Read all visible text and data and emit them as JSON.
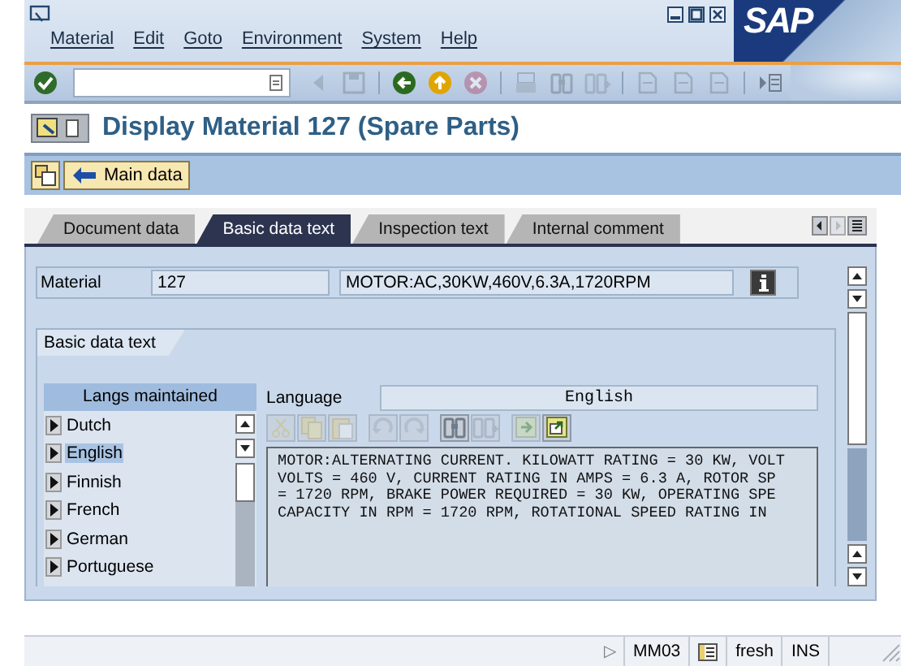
{
  "menu_bar": {
    "items": [
      "Material",
      "Edit",
      "Goto",
      "Environment",
      "System",
      "Help"
    ],
    "logo": "SAP"
  },
  "standard_toolbar": {
    "items": [
      {
        "kind": "enter",
        "disabled": false
      },
      {
        "kind": "command_field"
      },
      {
        "kind": "back_triangle",
        "disabled": true
      },
      {
        "kind": "save",
        "disabled": true
      },
      {
        "kind": "sep"
      },
      {
        "kind": "back",
        "disabled": false
      },
      {
        "kind": "exit",
        "disabled": false
      },
      {
        "kind": "cancel",
        "disabled": true
      },
      {
        "kind": "sep"
      },
      {
        "kind": "print",
        "disabled": true
      },
      {
        "kind": "find",
        "disabled": true
      },
      {
        "kind": "find_next",
        "disabled": true
      },
      {
        "kind": "sep"
      },
      {
        "kind": "page",
        "disabled": true
      },
      {
        "kind": "page",
        "disabled": true
      },
      {
        "kind": "page",
        "disabled": true
      },
      {
        "kind": "sep"
      },
      {
        "kind": "layout",
        "disabled": false
      }
    ]
  },
  "title": "Display Material 127 (Spare Parts)",
  "application_toolbar": {
    "buttons": [
      {
        "kind": "icon"
      },
      {
        "kind": "labeled",
        "label": "Main data"
      }
    ]
  },
  "tabs": [
    {
      "label": "Document data",
      "selected": false
    },
    {
      "label": "Basic data text",
      "selected": true
    },
    {
      "label": "Inspection text",
      "selected": false
    },
    {
      "label": "Internal comment",
      "selected": false
    }
  ],
  "material": {
    "label": "Material",
    "number": "127",
    "description": "MOTOR:AC,30KW,460V,6.3A,1720RPM"
  },
  "group": {
    "title": "Basic data text",
    "languages": {
      "header": "Langs maintained",
      "items": [
        {
          "label": "Dutch",
          "selected": false
        },
        {
          "label": "English",
          "selected": true
        },
        {
          "label": "Finnish",
          "selected": false
        },
        {
          "label": "French",
          "selected": false
        },
        {
          "label": "German",
          "selected": false
        },
        {
          "label": "Portuguese",
          "selected": false
        }
      ]
    },
    "language_label": "Language",
    "language_value": "English",
    "editor_toolbar": [
      {
        "kind": "cut",
        "disabled": true
      },
      {
        "kind": "copy",
        "disabled": true
      },
      {
        "kind": "paste",
        "disabled": true
      },
      {
        "kind": "sep"
      },
      {
        "kind": "undo",
        "disabled": true
      },
      {
        "kind": "redo",
        "disabled": true
      },
      {
        "kind": "sep"
      },
      {
        "kind": "find",
        "disabled": false
      },
      {
        "kind": "find_next",
        "disabled": true
      },
      {
        "kind": "sep"
      },
      {
        "kind": "import",
        "disabled": true
      },
      {
        "kind": "export",
        "disabled": false
      }
    ],
    "text_lines": [
      "MOTOR:ALTERNATING CURRENT. KILOWATT RATING = 30 KW, VOLT",
      "VOLTS = 460 V, CURRENT RATING IN AMPS = 6.3 A, ROTOR SP",
      "= 1720 RPM, BRAKE POWER REQUIRED = 30 KW, OPERATING SPE",
      "CAPACITY IN RPM = 1720 RPM, ROTATIONAL SPEED RATING IN"
    ]
  },
  "status_bar": {
    "marker": "▷",
    "transaction": "MM03",
    "server": "fresh",
    "mode": "INS"
  }
}
